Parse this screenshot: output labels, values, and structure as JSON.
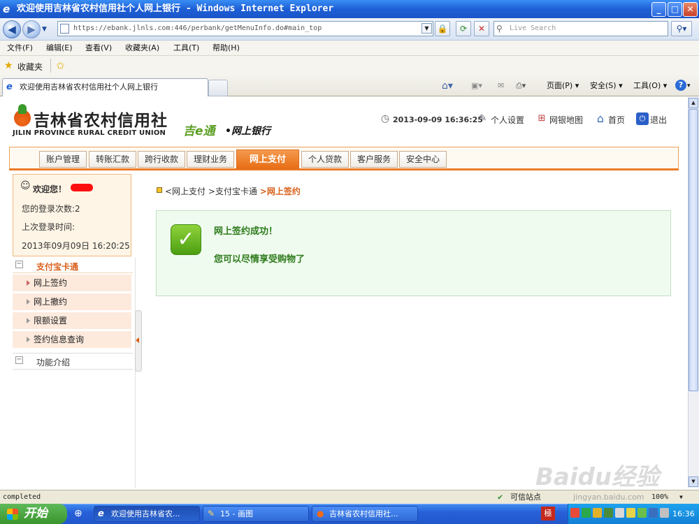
{
  "window": {
    "title": "欢迎使用吉林省农村信用社个人网上银行 - Windows Internet Explorer",
    "minimize": "_",
    "maximize": "□",
    "close": "✕"
  },
  "addressbar": {
    "url": "https://ebank.jlnls.com:446/perbank/getMenuInfo.do#main_top",
    "search_placeholder": "Live Search"
  },
  "menu": [
    "文件(F)",
    "编辑(E)",
    "查看(V)",
    "收藏夹(A)",
    "工具(T)",
    "帮助(H)"
  ],
  "favorites": {
    "label": "收藏夹"
  },
  "tab": {
    "title": "欢迎使用吉林省农村信用社个人网上银行"
  },
  "commandbar": {
    "page": "页面(P)",
    "safety": "安全(S)",
    "tools": "工具(O)"
  },
  "site": {
    "name_cn": "吉林省农村信用社",
    "name_en": "JILIN PROVINCE RURAL CREDIT UNION",
    "brand": "吉e通",
    "brand_suffix": "•网上银行",
    "datetime": "2013-09-09 16:36:25",
    "top_links": [
      "个人设置",
      "网银地图",
      "首页",
      "退出"
    ]
  },
  "nav": {
    "tabs": [
      "账户管理",
      "转账汇款",
      "跨行收款",
      "理财业务",
      "网上支付",
      "个人贷款",
      "客户服务",
      "安全中心"
    ],
    "active": "网上支付"
  },
  "user": {
    "welcome": "欢迎您！",
    "login_count": "您的登录次数:2",
    "last_login_label": "上次登录时间:",
    "last_login_time": "2013年09月09日  16:20:25"
  },
  "sidebar": {
    "section": "支付宝卡通",
    "items": [
      "网上签约",
      "网上撤约",
      "限额设置",
      "签约信息查询"
    ],
    "footer": "功能介绍"
  },
  "breadcrumb": {
    "parts": [
      "<网上支付",
      ">支付宝卡通",
      ">网上签约"
    ]
  },
  "message": {
    "title": "网上签约成功！",
    "body": "您可以尽情享受购物了"
  },
  "status": {
    "text": "completed",
    "zone": "可信站点",
    "zoom": "100%"
  },
  "taskbar": {
    "start": "开始",
    "tasks": [
      "欢迎使用吉林省农...",
      "15 - 画图",
      "吉林省农村信用社..."
    ],
    "clock": "16:36"
  },
  "watermark": {
    "text": "Baidu经验",
    "sub": "jingyan.baidu.com"
  },
  "colors": {
    "accent": "#ec7a26",
    "success": "#2d7b1b",
    "titlebar": "#1e5fd6"
  }
}
